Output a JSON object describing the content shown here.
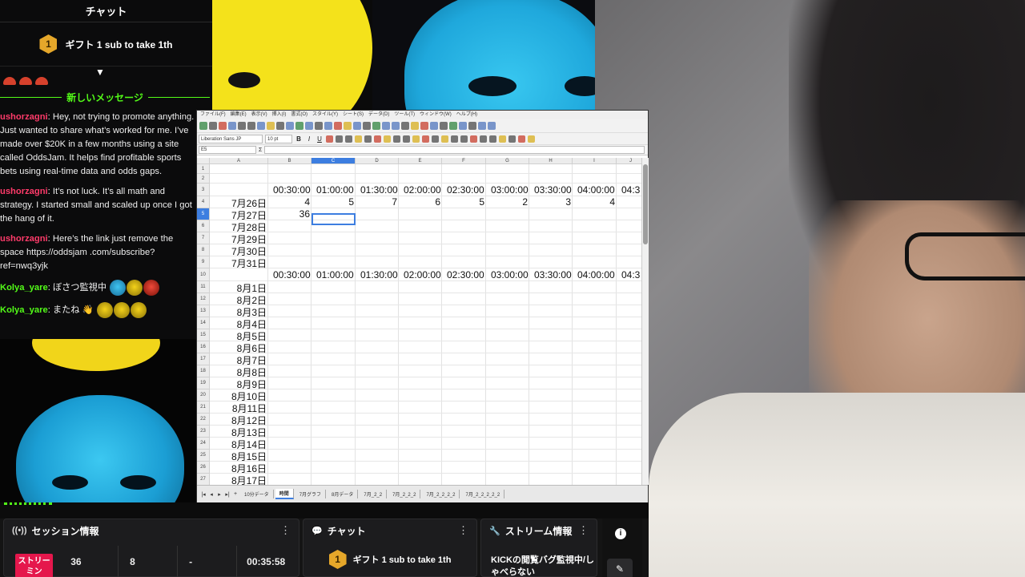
{
  "chat": {
    "title": "チャット",
    "gift": {
      "badge": "1",
      "text": "ギフト 1 sub to take 1th"
    },
    "new_messages": "新しいメッセージ",
    "messages": [
      {
        "user": "ushorzagni",
        "text": ": Hey, not trying to promote anything. Just wanted to share what’s worked for me. I’ve made over $20K in a few months using a site called OddsJam. It helps find profitable sports bets using real-time data and odds gaps."
      },
      {
        "user": "ushorzagni",
        "text": ": It’s not luck. It’s all math and strategy. I started small and scaled up once I got the hang of it."
      },
      {
        "user": "ushorzagni",
        "text": ": Here’s the link just remove the space https://oddsjam .com/subscribe?ref=nwq3yjk"
      },
      {
        "user": "Kolya_yare",
        "text": ": ぼさつ監視中"
      },
      {
        "user": "Kolya_yare",
        "text": ": またね 👋"
      }
    ]
  },
  "spreadsheet": {
    "menus": [
      "ファイル(F)",
      "編集(E)",
      "表示(V)",
      "挿入(I)",
      "書式(O)",
      "スタイル(Y)",
      "シート(S)",
      "データ(D)",
      "ツール(T)",
      "ウィンドウ(W)",
      "ヘルプ(H)"
    ],
    "font_name": "Liberation Sans JP",
    "font_size": "10 pt",
    "cell_ref": "E5",
    "columns": [
      "A",
      "B",
      "C",
      "D",
      "E",
      "F",
      "G",
      "H",
      "I",
      "J"
    ],
    "selected_column": "C",
    "selected_row": "5",
    "rows": [
      "1",
      "2",
      "3",
      "4",
      "5",
      "6",
      "7",
      "8",
      "9",
      "10",
      "11",
      "12",
      "13",
      "14",
      "15",
      "16",
      "17",
      "18",
      "19",
      "20",
      "21",
      "22",
      "23",
      "24",
      "25",
      "26",
      "27"
    ],
    "time_headers_top": [
      "00:30:00",
      "01:00:00",
      "01:30:00",
      "02:00:00",
      "02:30:00",
      "03:00:00",
      "03:30:00",
      "04:00:00",
      "04:3"
    ],
    "row4_values": [
      "4",
      "5",
      "7",
      "6",
      "5",
      "2",
      "3",
      "4"
    ],
    "row5_value": "36",
    "dates_top": [
      "7月26日",
      "7月27日",
      "7月28日",
      "7月29日",
      "7月30日",
      "7月31日"
    ],
    "time_headers_mid": [
      "00:30:00",
      "01:00:00",
      "01:30:00",
      "02:00:00",
      "02:30:00",
      "03:00:00",
      "03:30:00",
      "04:00:00",
      "04:3"
    ],
    "dates_bottom": [
      "8月1日",
      "8月2日",
      "8月3日",
      "8月4日",
      "8月5日",
      "8月6日",
      "8月7日",
      "8月8日",
      "8月9日",
      "8月10日",
      "8月11日",
      "8月12日",
      "8月13日",
      "8月14日",
      "8月15日",
      "8月16日",
      "8月17日"
    ],
    "tabs": [
      "10分データ",
      "時間",
      "7月グラフ",
      "8月データ",
      "7月_2_2",
      "7月_2_2_2",
      "7月_2_2_2_2",
      "7月_2_2_2_2_2"
    ],
    "active_tab": "時間"
  },
  "dashboard": {
    "session": {
      "title": "セッション情報",
      "live_label": "ストリーミン",
      "viewers": "36",
      "followers": "8",
      "subs": "-",
      "uptime": "00:35:58"
    },
    "chat": {
      "title": "チャット",
      "gift_badge": "1",
      "gift_text": "ギフト 1 sub to take 1th"
    },
    "stream_info": {
      "title": "ストリーム情報",
      "stream_title": "KICKの閲覧バグ監視中/しゃべらない"
    },
    "menu_glyph": "⋮",
    "info_glyph": "i",
    "edit_glyph": "✎"
  }
}
